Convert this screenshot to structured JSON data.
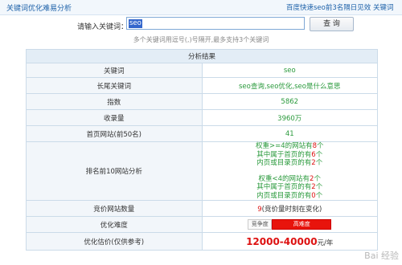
{
  "header": {
    "title": "关键词优化难易分析",
    "link_ranking": "百度快速seo前3名隔日见效",
    "link_other": "关键词"
  },
  "search": {
    "label": "请输入关键词：",
    "value": "seo",
    "button": "查 询",
    "hint": "多个关键词用逗号(,)号隔开,最多支持3个关键词"
  },
  "results": {
    "heading": "分析结果",
    "rows": {
      "keyword": {
        "label": "关键词",
        "value": "seo"
      },
      "longtail": {
        "label": "长尾关键词",
        "value": "seo查询,seo优化,seo是什么意思"
      },
      "index": {
        "label": "指数",
        "value": "5862"
      },
      "indexed": {
        "label": "收录量",
        "value": "3960万"
      },
      "homepage": {
        "label": "首页网站(前50名)",
        "value": "41"
      },
      "ranking": {
        "label": "排名前10网站分析",
        "lines_a": [
          "权重>=4的网站有",
          "8",
          "个"
        ],
        "lines_a2": [
          "其中属于首页的有",
          "6",
          "个"
        ],
        "lines_a3": [
          "内页或目录页的有",
          "2",
          "个"
        ],
        "lines_b": [
          "权重<4的网站有",
          "2",
          "个"
        ],
        "lines_b2": [
          "其中属于首页的有",
          "2",
          "个"
        ],
        "lines_b3": [
          "内页或目录页的有",
          "0",
          "个"
        ]
      },
      "bid": {
        "label": "竞价网站数量",
        "value": "9",
        "suffix": "(竞价量时刻在变化)"
      },
      "difficulty": {
        "label": "优化难度",
        "tag": "竞争度",
        "level": "高难度"
      },
      "price": {
        "label": "优化估价(仅供参考)",
        "value": "12000-40000",
        "unit": "元/年"
      }
    }
  },
  "watermark": "Bai 经验",
  "colors": {
    "link": "#1a5fa8",
    "green": "#2a9a3c",
    "red": "#d11"
  }
}
